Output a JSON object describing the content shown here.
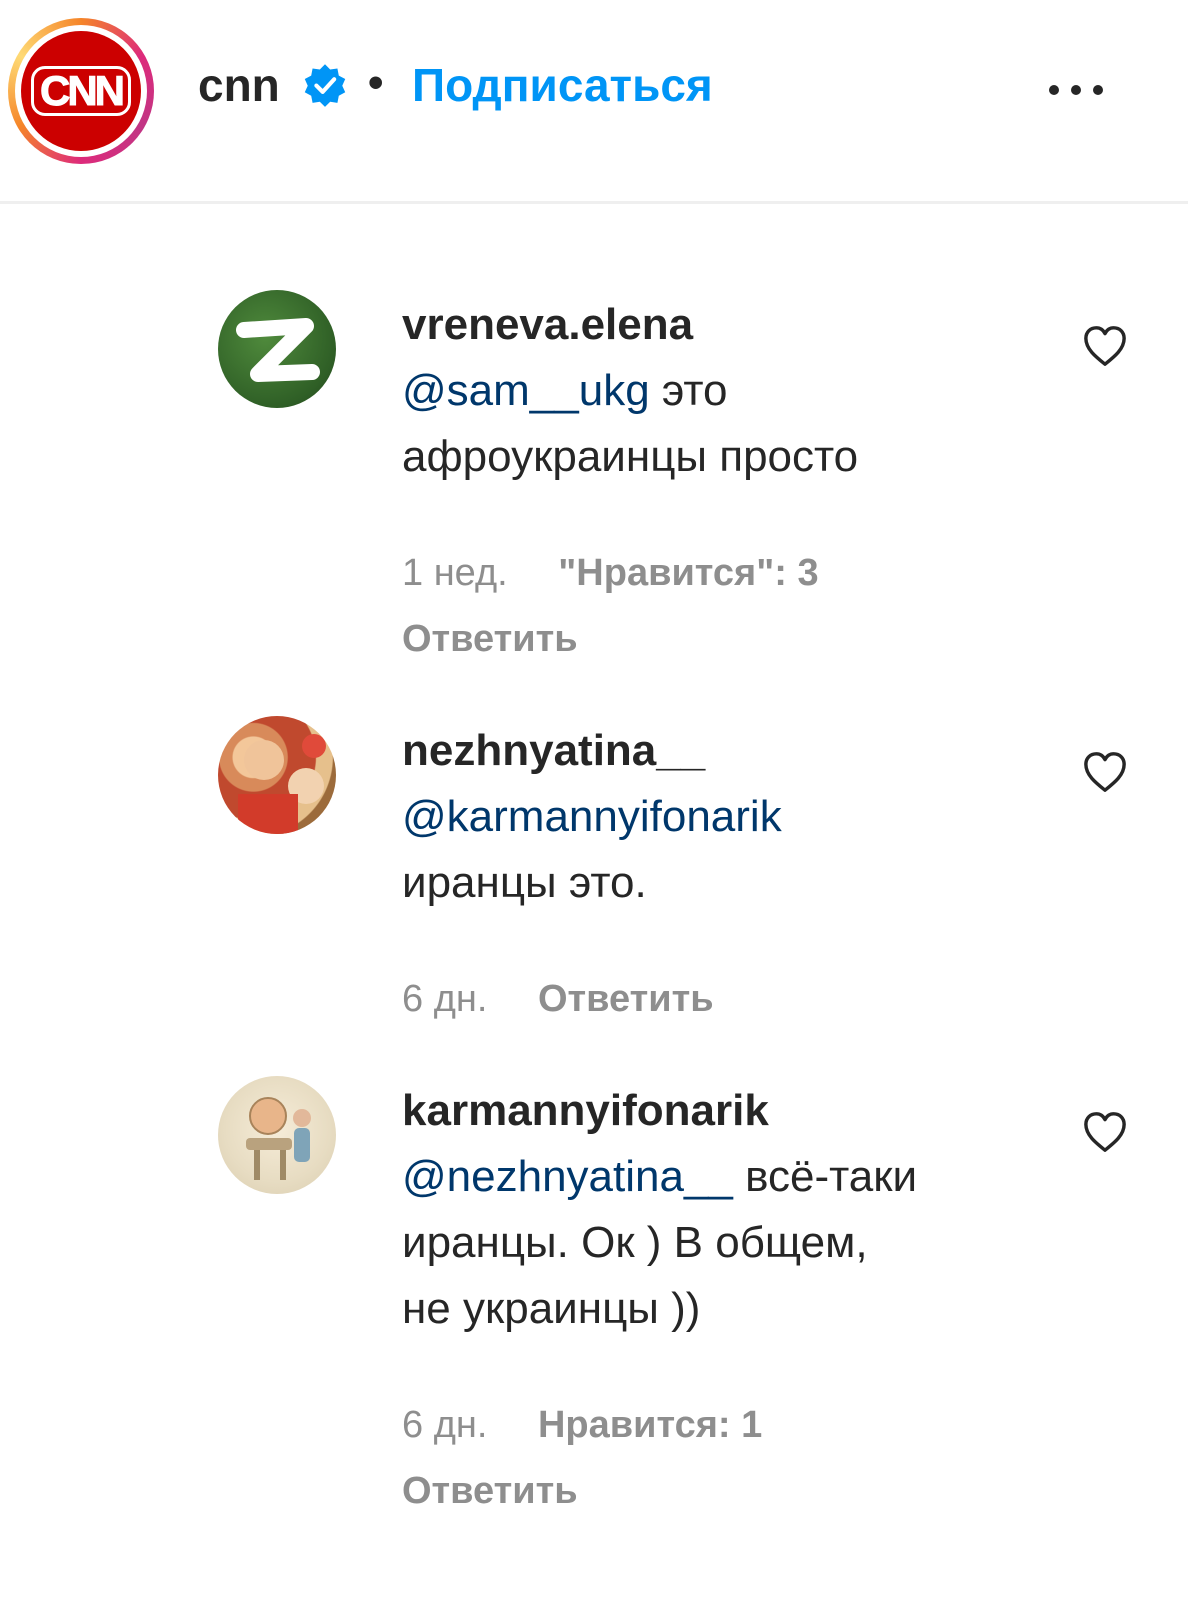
{
  "header": {
    "account": "cnn",
    "logo_text": "CNN",
    "separator": "•",
    "follow_label": "Подписаться"
  },
  "comments": [
    {
      "username": "vreneva.elena",
      "mention": "@sam__ukg",
      "text_line1": " это",
      "text_line2": "афроукраинцы просто",
      "time": "1 нед.",
      "likes": "\"Нравится\": 3",
      "reply": "Ответить"
    },
    {
      "username": "nezhnyatina__",
      "mention": "@karmannyifonarik",
      "text_line2": "иранцы это.",
      "time": "6 дн.",
      "reply": "Ответить"
    },
    {
      "username": "karmannyifonarik",
      "mention": "@nezhnyatina__",
      "text_line1": " всё-таки",
      "text_line2": "иранцы. Ок ) В общем,",
      "text_line3": "не украинцы ))",
      "time": "6 дн.",
      "likes": "Нравится: 1",
      "reply": "Ответить"
    }
  ],
  "colors": {
    "accent": "#0095f6",
    "mention": "#00376b",
    "muted": "#8e8e8e",
    "cnn_red": "#cc0000"
  }
}
